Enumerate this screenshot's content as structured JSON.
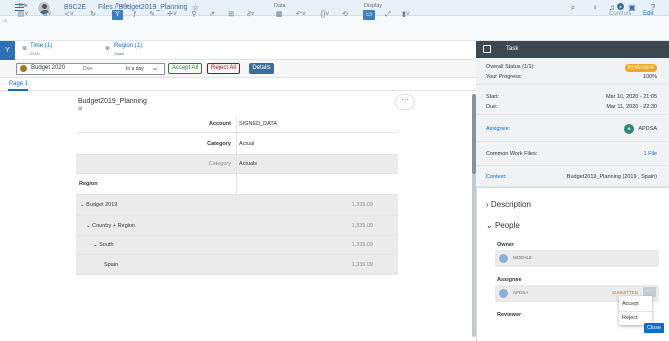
{
  "shell": {
    "company": "B9C2E",
    "breadcrumb": "Files / Budget2019_Planning"
  },
  "toolbar": {
    "groups": [
      "File",
      "Tools",
      "Data",
      "Display"
    ],
    "controls": "Controls",
    "edit": "Edit"
  },
  "filters": [
    {
      "title": "Time (1)",
      "sub": "2019"
    },
    {
      "title": "Region (1)",
      "sub": "Spain"
    }
  ],
  "actionbar": {
    "version": "Budget 2020",
    "due_label": "Due:",
    "due_value": "In a day",
    "accept_all": "Accept All",
    "reject_all": "Reject All",
    "details": "Details"
  },
  "page_tab": "Page 1",
  "table": {
    "title": "Budget2019_Planning",
    "rows": [
      {
        "left": "Account",
        "right": "SIGNED_DATA"
      },
      {
        "left": "Category",
        "right": "Actual"
      },
      {
        "left": "Category",
        "right": "Actuals"
      }
    ],
    "region_header": "Region",
    "data_rows": [
      {
        "label": "Budget 2019",
        "value": "1,339.09"
      },
      {
        "label": "Country + Region",
        "value": "1,339.09"
      },
      {
        "label": "South",
        "value": "1,339.09"
      },
      {
        "label": "Spain",
        "value": "1,339.09"
      }
    ]
  },
  "panel": {
    "header": "Task",
    "overall_label": "Overall Status (1/1):",
    "overall_value": "IN REVIEW",
    "progress_label": "Your Progress:",
    "progress_value": "100%",
    "start_label": "Start:",
    "start_value": "Mar 10, 2020 - 21:05",
    "due_label": "Due:",
    "due_value": "Mar 11, 2020 - 22:30",
    "assignee_label": "Assignee:",
    "assignee_value": "APDSA",
    "files_label": "Common Work Files:",
    "files_value": "1 File",
    "context_label": "Context:",
    "context_value": "Budget2019_Planning (2019 , Spain)",
    "description": "Description",
    "people": "People",
    "owner_label": "Owner",
    "owner_name": "MOEHL8",
    "assignee_sec_label": "Assignee",
    "assignee_name": "APDSA",
    "assignee_status": "SUBMITTED",
    "reviewer_label": "Reviewer",
    "menu": [
      "Accept",
      "Reject"
    ],
    "close": "Close"
  }
}
